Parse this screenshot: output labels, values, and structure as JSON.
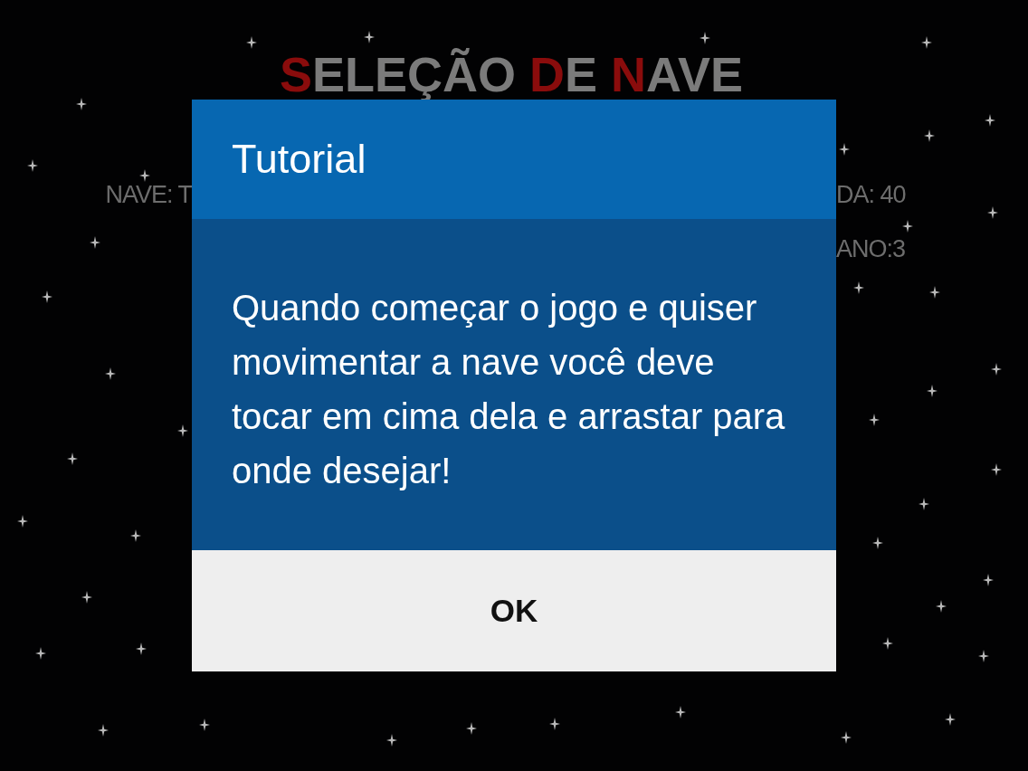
{
  "background": {
    "title": "SELEÇÃO DE NAVE",
    "stats_left": [
      "NAVE: T"
    ],
    "stats_right": [
      "DA: 40",
      "ANO:3"
    ]
  },
  "dialog": {
    "title": "Tutorial",
    "message": "Quando começar o jogo e quiser movimentar a nave você deve tocar em cima dela e arrastar para onde desejar!",
    "buttons": [
      {
        "label": "OK"
      }
    ]
  }
}
